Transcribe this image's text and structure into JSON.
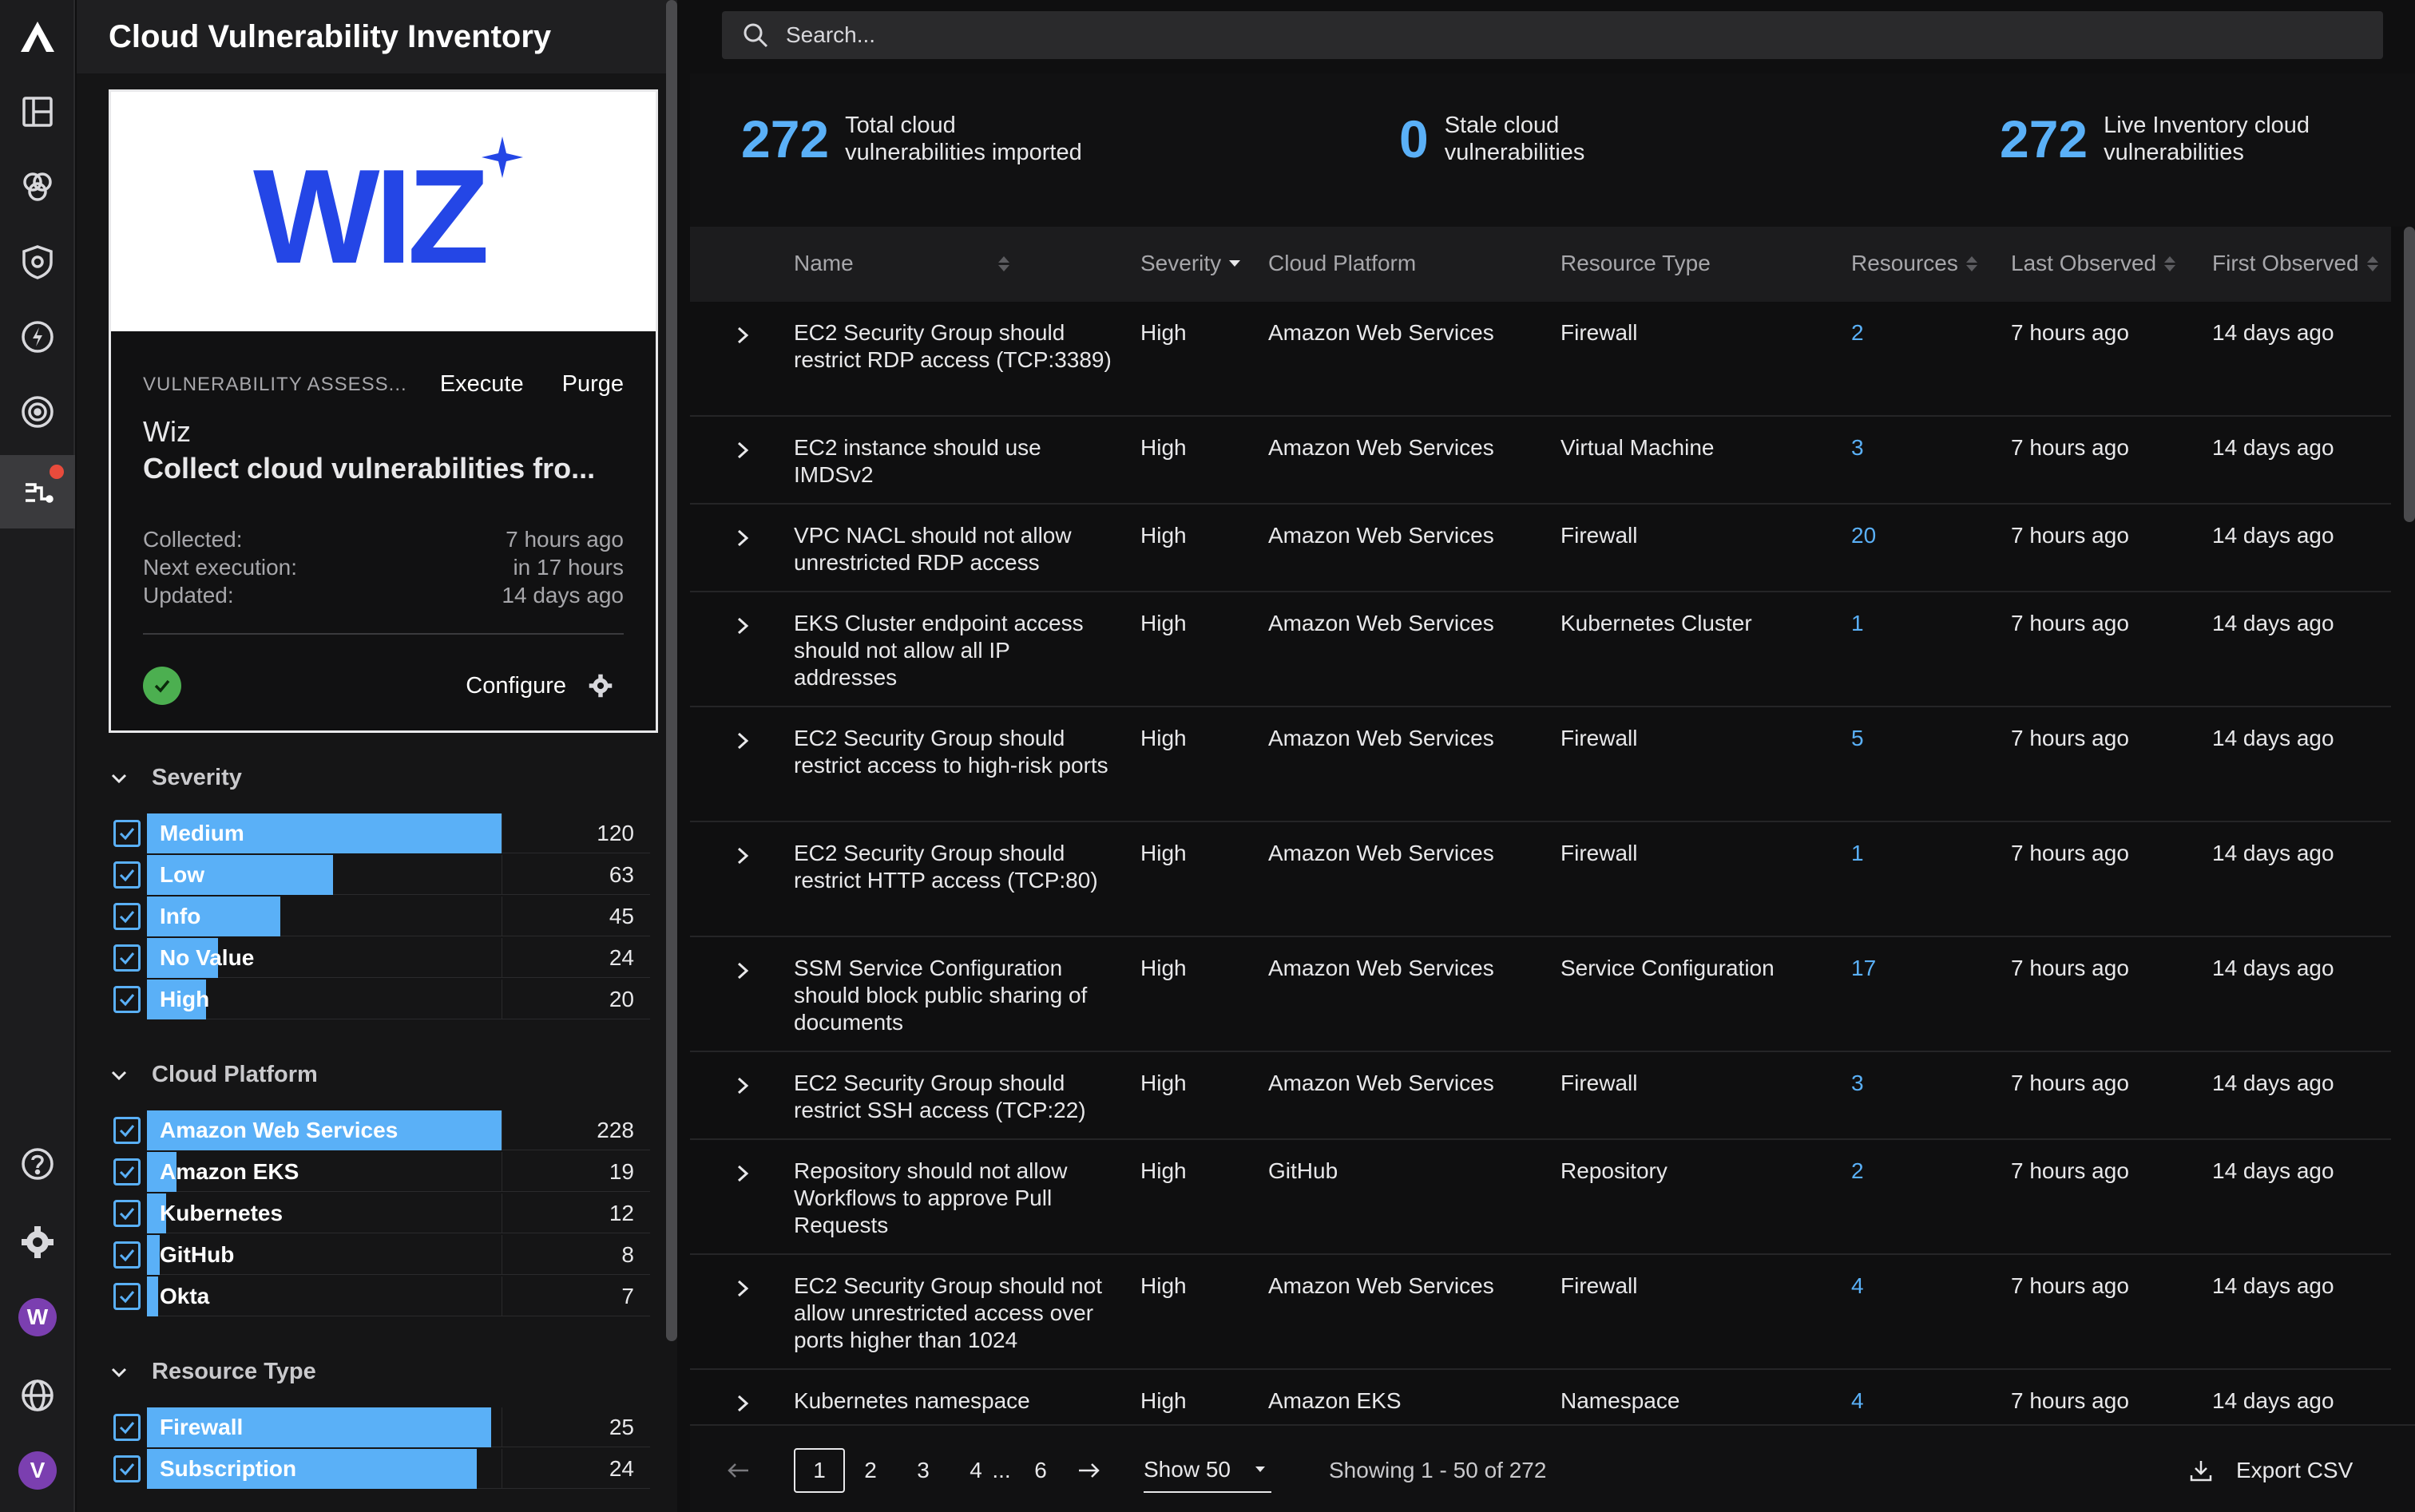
{
  "app": {
    "title": "Cloud Vulnerability Inventory"
  },
  "rail": {
    "avatars": [
      "W",
      "V"
    ]
  },
  "source_card": {
    "logo_text": "WIZ",
    "assessment_label": "VULNERABILITY ASSESS...",
    "execute_label": "Execute",
    "purge_label": "Purge",
    "name": "Wiz",
    "title": "Collect cloud vulnerabilities fro...",
    "collected_label": "Collected:",
    "next_label": "Next execution:",
    "updated_label": "Updated:",
    "collected_value": "7 hours ago",
    "next_value": "in 17 hours",
    "updated_value": "14 days ago",
    "configure_label": "Configure",
    "status_color": "#4caf50"
  },
  "facets": {
    "severity": {
      "title": "Severity",
      "items": [
        {
          "label": "Medium",
          "count": "120",
          "fraction": 1.0
        },
        {
          "label": "Low",
          "count": "63",
          "fraction": 0.525
        },
        {
          "label": "Info",
          "count": "45",
          "fraction": 0.375
        },
        {
          "label": "No Value",
          "count": "24",
          "fraction": 0.2
        },
        {
          "label": "High",
          "count": "20",
          "fraction": 0.167
        }
      ]
    },
    "cloud_platform": {
      "title": "Cloud Platform",
      "items": [
        {
          "label": "Amazon Web Services",
          "count": "228",
          "fraction": 1.0
        },
        {
          "label": "Amazon EKS",
          "count": "19",
          "fraction": 0.083
        },
        {
          "label": "Kubernetes",
          "count": "12",
          "fraction": 0.053
        },
        {
          "label": "GitHub",
          "count": "8",
          "fraction": 0.035
        },
        {
          "label": "Okta",
          "count": "7",
          "fraction": 0.031
        }
      ]
    },
    "resource_type": {
      "title": "Resource Type",
      "items": [
        {
          "label": "Firewall",
          "count": "25",
          "fraction": 0.97
        },
        {
          "label": "Subscription",
          "count": "24",
          "fraction": 0.93
        }
      ]
    }
  },
  "search": {
    "placeholder": "Search..."
  },
  "stats": [
    {
      "value": "272",
      "line1": "Total cloud",
      "line2": "vulnerabilities imported"
    },
    {
      "value": "0",
      "line1": "Stale cloud",
      "line2": "vulnerabilities"
    },
    {
      "value": "272",
      "line1": "Live Inventory cloud",
      "line2": "vulnerabilities"
    }
  ],
  "table": {
    "columns": [
      "Name",
      "Severity",
      "Cloud Platform",
      "Resource Type",
      "Resources",
      "Last Observed",
      "First Observed"
    ],
    "rows": [
      {
        "name": "EC2 Security Group should restrict RDP access (TCP:3389)",
        "severity": "High",
        "platform": "Amazon Web Services",
        "type": "Firewall",
        "resources": "2",
        "last": "7 hours ago",
        "first": "14 days ago"
      },
      {
        "name": "EC2 instance should use IMDSv2",
        "severity": "High",
        "platform": "Amazon Web Services",
        "type": "Virtual Machine",
        "resources": "3",
        "last": "7 hours ago",
        "first": "14 days ago"
      },
      {
        "name": "VPC NACL should not allow unrestricted RDP access",
        "severity": "High",
        "platform": "Amazon Web Services",
        "type": "Firewall",
        "resources": "20",
        "last": "7 hours ago",
        "first": "14 days ago"
      },
      {
        "name": "EKS Cluster endpoint access should not allow all IP addresses",
        "severity": "High",
        "platform": "Amazon Web Services",
        "type": "Kubernetes Cluster",
        "resources": "1",
        "last": "7 hours ago",
        "first": "14 days ago"
      },
      {
        "name": "EC2 Security Group should restrict access to high-risk ports",
        "severity": "High",
        "platform": "Amazon Web Services",
        "type": "Firewall",
        "resources": "5",
        "last": "7 hours ago",
        "first": "14 days ago"
      },
      {
        "name": "EC2 Security Group should restrict HTTP access (TCP:80)",
        "severity": "High",
        "platform": "Amazon Web Services",
        "type": "Firewall",
        "resources": "1",
        "last": "7 hours ago",
        "first": "14 days ago"
      },
      {
        "name": "SSM Service Configuration should block public sharing of documents",
        "severity": "High",
        "platform": "Amazon Web Services",
        "type": "Service Configuration",
        "resources": "17",
        "last": "7 hours ago",
        "first": "14 days ago"
      },
      {
        "name": "EC2 Security Group should restrict SSH access (TCP:22)",
        "severity": "High",
        "platform": "Amazon Web Services",
        "type": "Firewall",
        "resources": "3",
        "last": "7 hours ago",
        "first": "14 days ago"
      },
      {
        "name": "Repository should not allow Workflows to approve Pull Requests",
        "severity": "High",
        "platform": "GitHub",
        "type": "Repository",
        "resources": "2",
        "last": "7 hours ago",
        "first": "14 days ago"
      },
      {
        "name": "EC2 Security Group should not allow unrestricted access over ports higher than 1024",
        "severity": "High",
        "platform": "Amazon Web Services",
        "type": "Firewall",
        "resources": "4",
        "last": "7 hours ago",
        "first": "14 days ago"
      },
      {
        "name": "Kubernetes namespace",
        "severity": "High",
        "platform": "Amazon EKS",
        "type": "Namespace",
        "resources": "4",
        "last": "7 hours ago",
        "first": "14 days ago"
      }
    ]
  },
  "pager": {
    "pages": [
      "1",
      "2",
      "3",
      "4",
      "...",
      "6"
    ],
    "current": "1",
    "show_label": "Show 50",
    "showing": "Showing 1 - 50 of 272",
    "export_label": "Export CSV"
  },
  "colors": {
    "accent": "#5ab0f7",
    "wiz_blue": "#2446e6"
  }
}
